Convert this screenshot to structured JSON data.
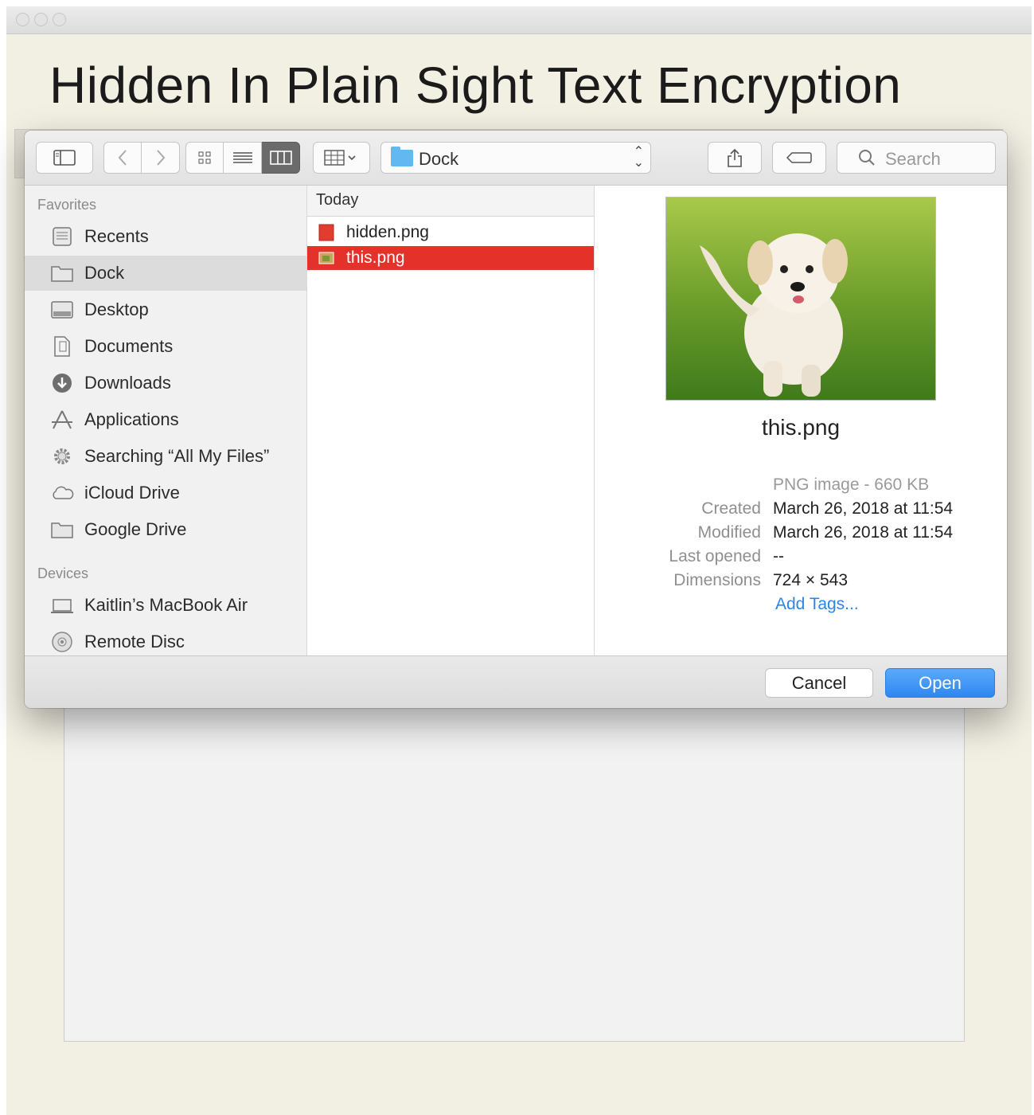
{
  "app": {
    "title": "Hidden In Plain Sight Text Encryption"
  },
  "dialog": {
    "toolbar": {
      "path_label": "Dock",
      "search_placeholder": "Search"
    },
    "sidebar": {
      "favorites_label": "Favorites",
      "favorites": [
        {
          "label": "Recents",
          "icon": "recents-icon"
        },
        {
          "label": "Dock",
          "icon": "folder-icon",
          "selected": true
        },
        {
          "label": "Desktop",
          "icon": "desktop-icon"
        },
        {
          "label": "Documents",
          "icon": "documents-icon"
        },
        {
          "label": "Downloads",
          "icon": "downloads-icon"
        },
        {
          "label": "Applications",
          "icon": "applications-icon"
        },
        {
          "label": "Searching “All My Files”",
          "icon": "gear-icon"
        },
        {
          "label": "iCloud Drive",
          "icon": "cloud-icon"
        },
        {
          "label": "Google Drive",
          "icon": "folder-icon"
        }
      ],
      "devices_label": "Devices",
      "devices": [
        {
          "label": "Kaitlin’s MacBook Air",
          "icon": "laptop-icon"
        },
        {
          "label": "Remote Disc",
          "icon": "disc-icon"
        }
      ]
    },
    "file_column": {
      "header": "Today",
      "files": [
        {
          "name": "hidden.png",
          "icon": "png-file-icon",
          "selected": false
        },
        {
          "name": "this.png",
          "icon": "png-file-icon",
          "selected": true
        }
      ]
    },
    "preview": {
      "filename": "this.png",
      "kind": "PNG image - 660 KB",
      "created_label": "Created",
      "created": "March 26, 2018 at 11:54",
      "modified_label": "Modified",
      "modified": "March 26, 2018 at 11:54",
      "last_opened_label": "Last opened",
      "last_opened": "--",
      "dimensions_label": "Dimensions",
      "dimensions": "724 × 543",
      "add_tags": "Add Tags..."
    },
    "footer": {
      "cancel": "Cancel",
      "open": "Open"
    }
  },
  "colors": {
    "selection": "#e4322a",
    "accent": "#2f87f1",
    "background": "#f2efe3"
  }
}
